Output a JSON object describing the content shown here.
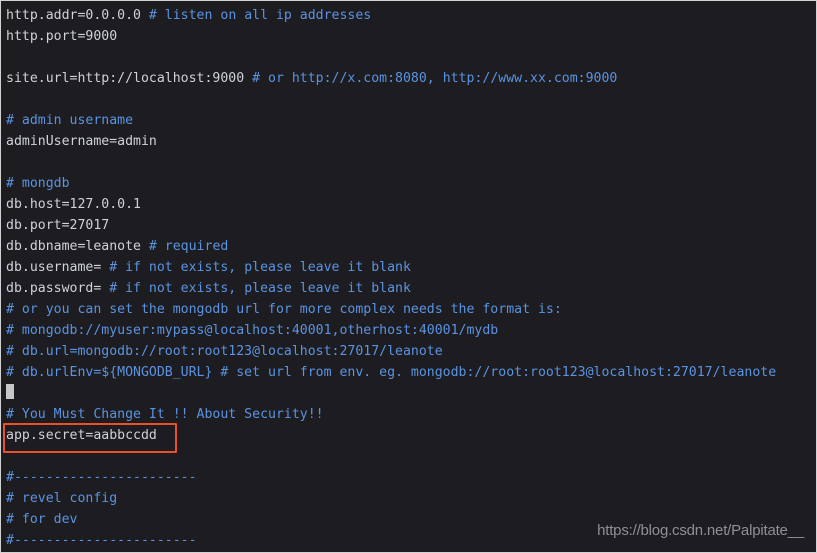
{
  "editor": {
    "background_color": "#1c1c21",
    "text_color": "#cfd2d6",
    "comment_color": "#5b93e0",
    "highlight_color": "#e8512a",
    "cursor_color": "#c7c7c7",
    "lines": [
      {
        "type": "code",
        "code": "http.addr=0.0.0.0 ",
        "comment": "# listen on all ip addresses"
      },
      {
        "type": "code",
        "code": "http.port=9000",
        "comment": ""
      },
      {
        "type": "blank",
        "code": "",
        "comment": ""
      },
      {
        "type": "code",
        "code": "site.url=http://localhost:9000 ",
        "comment": "# or http://x.com:8080, http://www.xx.com:9000"
      },
      {
        "type": "blank",
        "code": "",
        "comment": ""
      },
      {
        "type": "comment",
        "code": "",
        "comment": "# admin username"
      },
      {
        "type": "code",
        "code": "adminUsername=admin",
        "comment": ""
      },
      {
        "type": "blank",
        "code": "",
        "comment": ""
      },
      {
        "type": "comment",
        "code": "",
        "comment": "# mongdb"
      },
      {
        "type": "code",
        "code": "db.host=127.0.0.1",
        "comment": ""
      },
      {
        "type": "code",
        "code": "db.port=27017",
        "comment": ""
      },
      {
        "type": "code",
        "code": "db.dbname=leanote ",
        "comment": "# required"
      },
      {
        "type": "code",
        "code": "db.username= ",
        "comment": "# if not exists, please leave it blank"
      },
      {
        "type": "code",
        "code": "db.password= ",
        "comment": "# if not exists, please leave it blank"
      },
      {
        "type": "comment",
        "code": "",
        "comment": "# or you can set the mongodb url for more complex needs the format is:"
      },
      {
        "type": "comment",
        "code": "",
        "comment": "# mongodb://myuser:mypass@localhost:40001,otherhost:40001/mydb"
      },
      {
        "type": "comment",
        "code": "",
        "comment": "# db.url=mongodb://root:root123@localhost:27017/leanote"
      },
      {
        "type": "comment",
        "code": "",
        "comment": "# db.urlEnv=${MONGODB_URL} # set url from env. eg. mongodb://root:root123@localhost:27017/leanote"
      },
      {
        "type": "cursor",
        "code": "",
        "comment": ""
      },
      {
        "type": "comment",
        "code": "",
        "comment": "# You Must Change It !! About Security!!"
      },
      {
        "type": "code",
        "code": "app.secret=aabbccdd",
        "comment": ""
      },
      {
        "type": "blank",
        "code": "",
        "comment": ""
      },
      {
        "type": "comment",
        "code": "",
        "comment": "#-----------------------"
      },
      {
        "type": "comment",
        "code": "",
        "comment": "# revel config"
      },
      {
        "type": "comment",
        "code": "",
        "comment": "# for dev"
      },
      {
        "type": "comment",
        "code": "",
        "comment": "#-----------------------"
      }
    ]
  },
  "annotation": {
    "highlight_target_text": "app.secret=aabbccdd",
    "highlight_border_color": "#e8512a"
  },
  "watermark": {
    "text": "https://blog.csdn.net/Palpitate__"
  }
}
